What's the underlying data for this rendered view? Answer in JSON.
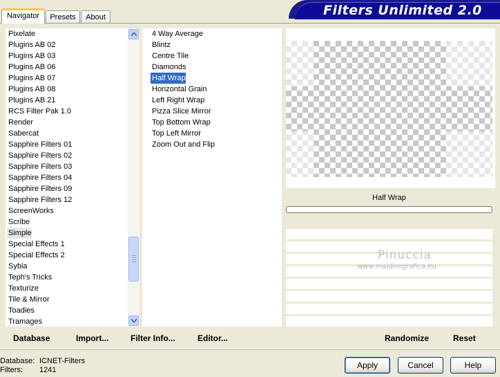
{
  "tabs": [
    "Navigator",
    "Presets",
    "About"
  ],
  "app_title": "Filters Unlimited 2.0",
  "categories": [
    "Pixelate",
    "Plugins AB 02",
    "Plugins AB 03",
    "Plugins AB 06",
    "Plugins AB 07",
    "Plugins AB 08",
    "Plugins AB 21",
    "RCS Filter Pak 1.0",
    "Render",
    "Sabercat",
    "Sapphire Filters 01",
    "Sapphire Filters 02",
    "Sapphire Filters 03",
    "Sapphire Filters 04",
    "Sapphire Filters 09",
    "Sapphire Filters 12",
    "ScreenWorks",
    "Scribe",
    "Simple",
    "Special Effects 1",
    "Special Effects 2",
    "Sybia",
    "Teph's Tricks",
    "Texturize",
    "Tile & Mirror",
    "Toadies",
    "Tramages"
  ],
  "selected_category": "Simple",
  "filters": [
    "4 Way Average",
    "Blintz",
    "Centre Tile",
    "Diamonds",
    "Half Wrap",
    "Horizontal Grain",
    "Left Right Wrap",
    "Pizza Slice Mirror",
    "Top Bottom Wrap",
    "Top Left Mirror",
    "Zoom Out and Flip"
  ],
  "selected_filter": "Half Wrap",
  "preview_filter_name": "Half Wrap",
  "watermark": {
    "name": "Pinuccia",
    "url": "www.maidiregrafica.eu"
  },
  "bottom_links": {
    "database": "Database",
    "import": "Import...",
    "filter_info": "Filter Info...",
    "editor": "Editor...",
    "randomize": "Randomize",
    "reset": "Reset"
  },
  "status": {
    "database_label": "Database:",
    "database_value": "ICNET-Filters",
    "filters_label": "Filters:",
    "filters_value": "1241"
  },
  "buttons": {
    "apply": "Apply",
    "cancel": "Cancel",
    "help": "Help"
  },
  "icons": {
    "scroll_up": "chevron-up-icon",
    "scroll_down": "chevron-down-icon"
  },
  "colors": {
    "selection": "#316ac5",
    "banner": "#0c0c99",
    "tab_accent": "#ffc83c"
  }
}
